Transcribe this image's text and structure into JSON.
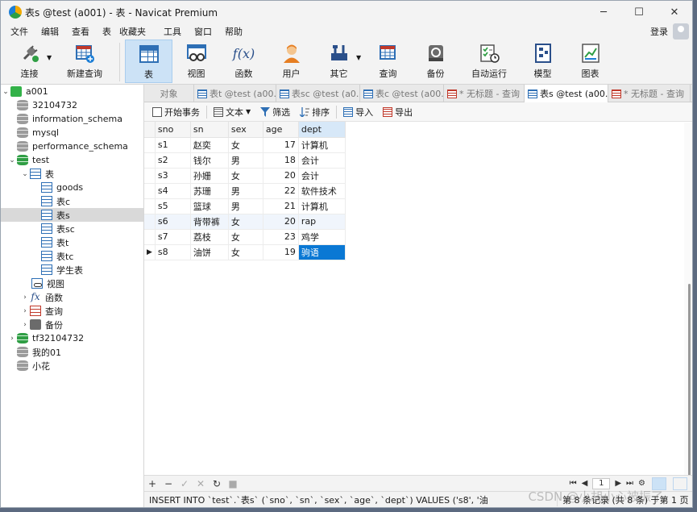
{
  "window": {
    "title": "表s @test (a001) - 表 - Navicat Premium",
    "controls": {
      "minimize": "─",
      "maximize": "☐",
      "close": "✕"
    }
  },
  "menu": {
    "items": [
      "文件",
      "编辑",
      "查看",
      "表",
      "收藏夹",
      "工具",
      "窗口",
      "帮助"
    ],
    "login": "登录"
  },
  "toolbar": {
    "connect": "连接",
    "new_query": "新建查询",
    "table": "表",
    "view": "视图",
    "function": "函数",
    "user": "用户",
    "other": "其它",
    "query": "查询",
    "backup": "备份",
    "automation": "自动运行",
    "model": "模型",
    "chart": "图表",
    "function_glyph": "f(x)"
  },
  "sidebar": {
    "connection": "a001",
    "databases": [
      "32104732",
      "information_schema",
      "mysql",
      "performance_schema"
    ],
    "open_db": "test",
    "tables_folder": "表",
    "tables": [
      "goods",
      "表c",
      "表s",
      "表sc",
      "表t",
      "表tc",
      "学生表"
    ],
    "other_nodes": [
      "视图",
      "函数",
      "查询",
      "备份"
    ],
    "function_glyph": "fx",
    "after": [
      "tf32104732",
      "我的01",
      "小花"
    ]
  },
  "tabs": [
    {
      "label": "对象"
    },
    {
      "label": "表t @test (a00..."
    },
    {
      "label": "表sc @test (a0..."
    },
    {
      "label": "表c @test (a00..."
    },
    {
      "label": "* 无标题 - 查询"
    },
    {
      "label": "表s @test (a00..."
    },
    {
      "label": "* 无标题 - 查询"
    }
  ],
  "subtoolbar": {
    "begin_transaction": "开始事务",
    "text": "文本",
    "filter": "筛选",
    "sort": "排序",
    "import": "导入",
    "export": "导出"
  },
  "grid": {
    "columns": [
      "sno",
      "sn",
      "sex",
      "age",
      "dept"
    ],
    "rows": [
      [
        "s1",
        "赵奕",
        "女",
        "17",
        "计算机"
      ],
      [
        "s2",
        "钱尔",
        "男",
        "18",
        "会计"
      ],
      [
        "s3",
        "孙姗",
        "女",
        "20",
        "会计"
      ],
      [
        "s4",
        "苏珊",
        "男",
        "22",
        "软件技术"
      ],
      [
        "s5",
        "篮球",
        "男",
        "21",
        "计算机"
      ],
      [
        "s6",
        "背带裤",
        "女",
        "20",
        "rap"
      ],
      [
        "s7",
        "荔枝",
        "女",
        "23",
        "鸡学"
      ],
      [
        "s8",
        "油饼",
        "女",
        "19",
        "驹语"
      ]
    ],
    "current_row_marker": "▶"
  },
  "bottombar": {
    "buttons": [
      "+",
      "−",
      "✓",
      "✕",
      "↻",
      "■"
    ],
    "nav": [
      "⏮",
      "◀",
      "▶",
      "⏭",
      "⚙"
    ],
    "page": "1"
  },
  "status": {
    "sql": "INSERT INTO `test`.`表s` (`sno`, `sn`, `sex`, `age`, `dept`) VALUES ('s8', '油",
    "records": "第 8 条记录 (共 8 条) 于第 1 页"
  },
  "watermark": "CSDN @小胡小心被振了",
  "colors": {
    "accent": "#0a78d4",
    "active_tool": "#cce2f6"
  }
}
